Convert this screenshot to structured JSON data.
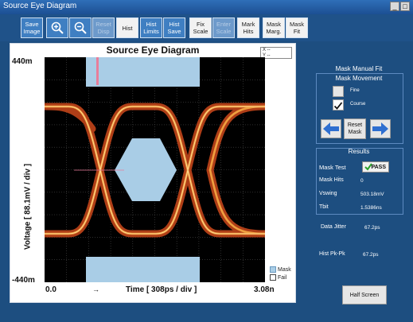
{
  "window": {
    "title": "Source Eye Diagram"
  },
  "toolbar": {
    "save_image": "Save\nImage",
    "zoom_in": "+",
    "zoom_out": "−",
    "reset_disp": "Reset\nDisp",
    "hist": "Hist",
    "hist_limits": "Hist\nLimits",
    "hist_save": "Hist\nSave",
    "fix_scale": "Fix\nScale",
    "enter_scale": "Enter\nScale",
    "mark_hits": "Mark\nHits",
    "mask_marg": "Mask\nMarg.",
    "mask_fit": "Mask\nFit"
  },
  "plot": {
    "title": "Source Eye Diagram",
    "y_top": "440m",
    "y_bottom": "-440m",
    "y_label": "Voltage   [ 88.1mV / div ]",
    "x_left": "0.0",
    "x_right": "3.08n",
    "x_label": "Time   [ 308ps / div ]",
    "readout_x": "X   --",
    "readout_y": "Y   --",
    "legend_mask": "Mask",
    "legend_fail": "Fail",
    "colors": {
      "background": "#000000",
      "trace": "#e8771f",
      "mask": "#a9cde6",
      "grid": "#4a4a4a",
      "marker": "#e87d9a"
    }
  },
  "side": {
    "mask_manual_fit": "Mask Manual Fit",
    "mask_movement": "Mask Movement",
    "fine": "Fine",
    "course": "Course",
    "reset_mask": "Reset\nMask",
    "results": "Results",
    "mask_test_label": "Mask Test",
    "mask_test_value": "PASS",
    "mask_hits_label": "Mask Hits",
    "mask_hits_value": "0",
    "vswing_label": "Vswing",
    "vswing_value": "503.18mV",
    "tbit_label": "Tbit",
    "tbit_value": "1.5386ns",
    "data_jitter_label": "Data Jitter",
    "data_jitter_value": "67.2ps",
    "hist_pkpk_label": "Hist Pk-Pk",
    "hist_pkpk_value": "67.2ps",
    "half_screen": "Half Screen"
  }
}
